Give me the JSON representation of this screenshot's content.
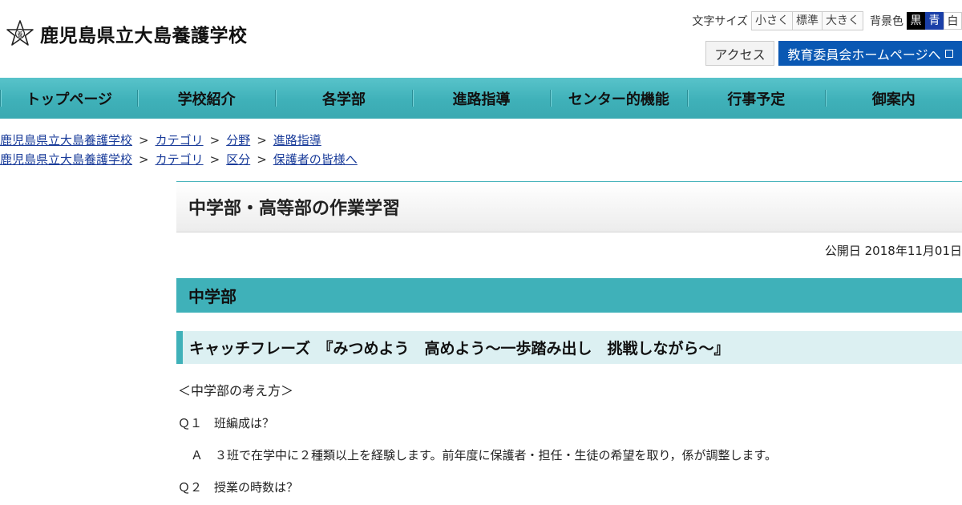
{
  "site": {
    "name": "鹿児島県立大島養護学校",
    "logo_icon": "school-emblem-icon"
  },
  "tools": {
    "font_size_label": "文字サイズ",
    "font_sizes": [
      "小さく",
      "標準",
      "大きく"
    ],
    "bg_label": "背景色",
    "bg_options": [
      "黒",
      "青",
      "白"
    ],
    "colors": {
      "black": "#000000",
      "blue": "#1a3fa8",
      "white": "#ffffff"
    }
  },
  "header_links": {
    "access": "アクセス",
    "education_board": "教育委員会ホームページへ"
  },
  "nav": {
    "items": [
      "トップページ",
      "学校紹介",
      "各学部",
      "進路指導",
      "センター的機能",
      "行事予定",
      "御案内"
    ],
    "color": "#3fb1b9"
  },
  "breadcrumbs": [
    [
      "鹿児島県立大島養護学校",
      "カテゴリ",
      "分野",
      "進路指導"
    ],
    [
      "鹿児島県立大島養護学校",
      "カテゴリ",
      "区分",
      "保護者の皆様へ"
    ]
  ],
  "breadcrumb_sep": ">",
  "article": {
    "title": "中学部・高等部の作業学習",
    "published": "公開日 2018年11月01日",
    "section_heading": "中学部",
    "catchphrase": "キャッチフレーズ　『みつめよう　高めよう～一歩踏み出し　挑戦しながら～』",
    "paragraphs": [
      "＜中学部の考え方＞",
      "Ｑ１　班編成は？",
      "Ａ　３班で在学中に２種類以上を経験します。前年度に保護者・担任・生徒の希望を取り，係が調整します。",
      "Ｑ２　授業の時数は？"
    ]
  }
}
